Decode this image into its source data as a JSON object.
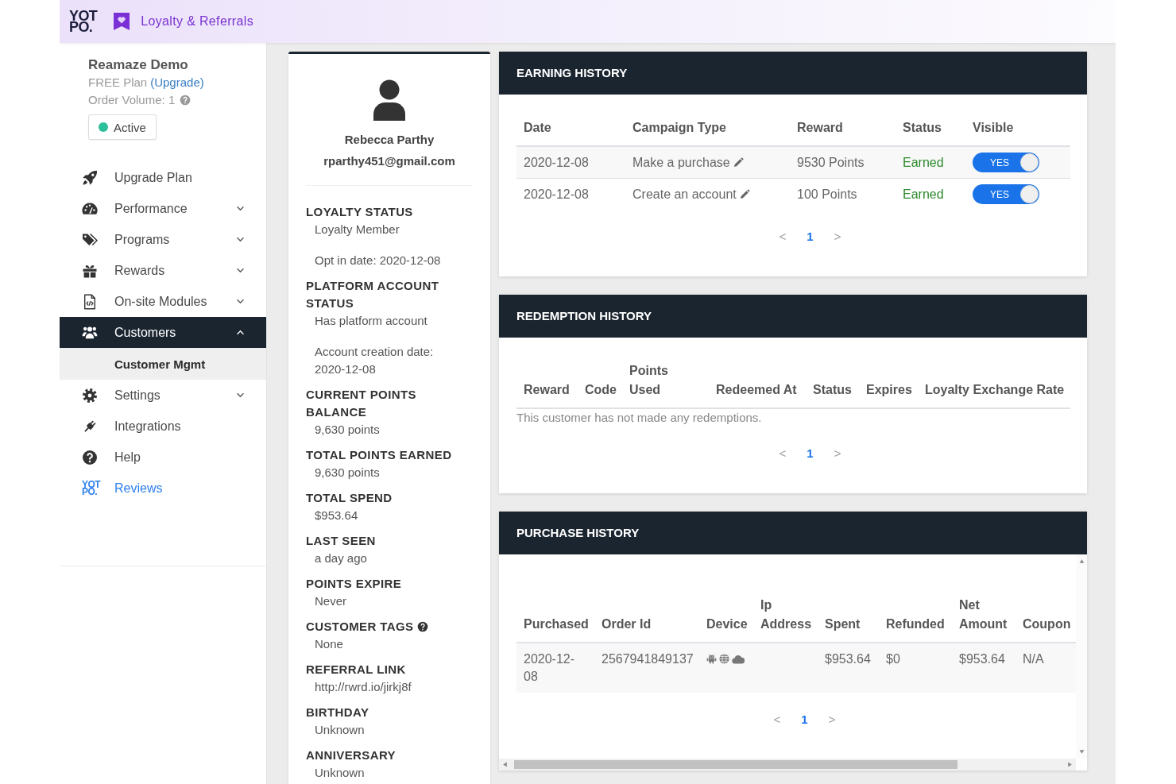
{
  "top_bar": {
    "logo_lines": [
      "YOT",
      "PO."
    ],
    "app_title": "Loyalty & Referrals"
  },
  "account": {
    "name": "Reamaze Demo",
    "plan": "FREE Plan",
    "upgrade_link": "(Upgrade)",
    "order_volume": "Order Volume: 1",
    "status": {
      "label": "Active",
      "active": true
    }
  },
  "sidebar": {
    "items": [
      {
        "kind": "link",
        "label": "Upgrade Plan",
        "selected": false
      },
      {
        "kind": "group",
        "label": "Performance",
        "selected": false,
        "expanded": false
      },
      {
        "kind": "group",
        "label": "Programs",
        "selected": false,
        "expanded": false
      },
      {
        "kind": "group",
        "label": "Rewards",
        "selected": false,
        "expanded": false
      },
      {
        "kind": "group",
        "label": "On-site Modules",
        "selected": false,
        "expanded": false
      },
      {
        "kind": "group",
        "label": "Customers",
        "selected": true,
        "expanded": true,
        "children": [
          {
            "label": "Customer Mgmt",
            "selected": true
          }
        ]
      },
      {
        "kind": "group",
        "label": "Settings",
        "selected": false,
        "expanded": false
      },
      {
        "kind": "link",
        "label": "Integrations",
        "selected": false
      },
      {
        "kind": "link",
        "label": "Help",
        "selected": false
      },
      {
        "kind": "external",
        "label": "Reviews",
        "selected": false,
        "logo_lines": [
          "YOT",
          "PO."
        ]
      }
    ]
  },
  "profile": {
    "name": "Rebecca Parthy",
    "email": "rparthy451@gmail.com",
    "sections": [
      {
        "heading": "LOYALTY STATUS",
        "info_icon": false,
        "values": [
          "Loyalty Member",
          "Opt in date: 2020-12-08"
        ]
      },
      {
        "heading": "PLATFORM ACCOUNT STATUS",
        "info_icon": false,
        "values": [
          "Has platform account",
          "Account creation date: 2020-12-08"
        ]
      },
      {
        "heading": "CURRENT POINTS BALANCE",
        "info_icon": false,
        "values": [
          "9,630 points"
        ]
      },
      {
        "heading": "TOTAL POINTS EARNED",
        "info_icon": false,
        "values": [
          "9,630 points"
        ]
      },
      {
        "heading": "TOTAL SPEND",
        "info_icon": false,
        "values": [
          "$953.64"
        ]
      },
      {
        "heading": "LAST SEEN",
        "info_icon": false,
        "values": [
          "a day ago"
        ]
      },
      {
        "heading": "POINTS EXPIRE",
        "info_icon": false,
        "values": [
          "Never"
        ]
      },
      {
        "heading": "CUSTOMER TAGS",
        "info_icon": true,
        "values": [
          "None"
        ]
      },
      {
        "heading": "REFERRAL LINK",
        "info_icon": false,
        "values": [
          "http://rwrd.io/jirkj8f"
        ]
      },
      {
        "heading": "BIRTHDAY",
        "info_icon": false,
        "values": [
          "Unknown"
        ]
      },
      {
        "heading": "ANNIVERSARY",
        "info_icon": false,
        "values": [
          "Unknown"
        ]
      }
    ]
  },
  "earning_history": {
    "title": "EARNING HISTORY",
    "columns": [
      "Date",
      "Campaign Type",
      "Reward",
      "Status",
      "Visible"
    ],
    "rows": [
      {
        "date": "2020-12-08",
        "campaign_type": "Make a purchase",
        "reward": "9530 Points",
        "status": "Earned",
        "visible": {
          "label": "YES",
          "on": true
        }
      },
      {
        "date": "2020-12-08",
        "campaign_type": "Create an account",
        "reward": "100 Points",
        "status": "Earned",
        "visible": {
          "label": "YES",
          "on": true
        }
      }
    ],
    "pagination": {
      "previous": "<",
      "pages": [
        {
          "label": "1",
          "selected": true
        }
      ],
      "next": ">"
    }
  },
  "redemption_history": {
    "title": "REDEMPTION HISTORY",
    "columns": [
      "Reward",
      "Code",
      "Points Used",
      "Redeemed At",
      "Status",
      "Expires",
      "Loyalty Exchange Rate"
    ],
    "empty_message": "This customer has not made any redemptions.",
    "pagination": {
      "previous": "<",
      "pages": [
        {
          "label": "1",
          "selected": true
        }
      ],
      "next": ">"
    }
  },
  "purchase_history": {
    "title": "PURCHASE HISTORY",
    "columns": [
      "Purchased",
      "Order Id",
      "Device",
      "Ip Address",
      "Spent",
      "Refunded",
      "Net Amount",
      "Coupon"
    ],
    "rows": [
      {
        "purchased": "2020-12-08",
        "order_id": "2567941849137",
        "spent": "$953.64",
        "refunded": "$0",
        "net_amount": "$953.64",
        "coupon": "N/A"
      }
    ],
    "pagination": {
      "previous": "<",
      "pages": [
        {
          "label": "1",
          "selected": true
        }
      ],
      "next": ">"
    }
  }
}
